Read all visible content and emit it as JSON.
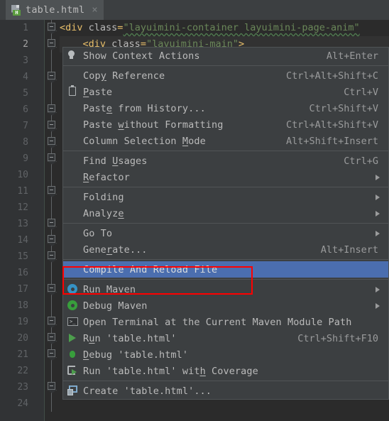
{
  "tab": {
    "filename": "table.html",
    "close_label": "×",
    "icon": "html-file-icon",
    "badge": "H"
  },
  "editor": {
    "line_numbers": [
      1,
      2,
      3,
      4,
      5,
      6,
      7,
      8,
      9,
      10,
      11,
      12,
      13,
      14,
      15,
      16,
      17,
      18,
      19,
      20,
      21,
      22,
      23,
      24
    ],
    "current_line": 2,
    "lines": [
      {
        "n": 1,
        "segments": [
          {
            "text": "<div",
            "type": "tag"
          },
          {
            "text": " ",
            "type": "plain"
          },
          {
            "text": "class",
            "type": "attr"
          },
          {
            "text": "=",
            "type": "tag"
          },
          {
            "text": "\"layuimini-container layuimini-page-anim\"",
            "type": "str"
          }
        ]
      },
      {
        "n": 2,
        "segments": [
          {
            "text": "    <div",
            "type": "tag"
          },
          {
            "text": " ",
            "type": "plain"
          },
          {
            "text": "class",
            "type": "attr"
          },
          {
            "text": "=",
            "type": "tag"
          },
          {
            "text": "\"layuimini-main\"",
            "type": "str"
          },
          {
            "text": ">",
            "type": "tag"
          }
        ]
      }
    ]
  },
  "context_menu": {
    "groups": [
      {
        "items": [
          {
            "label": "Show Context Actions",
            "shortcut": "Alt+Enter",
            "icon": "lightbulb-icon",
            "submenu": false,
            "selected": false
          }
        ]
      },
      {
        "items": [
          {
            "label": "Copy Reference",
            "shortcut": "Ctrl+Alt+Shift+C",
            "icon": "",
            "submenu": false,
            "selected": false,
            "mnemonic": 3
          },
          {
            "label": "Paste",
            "shortcut": "Ctrl+V",
            "icon": "clipboard-icon",
            "submenu": false,
            "selected": false,
            "mnemonic": 0
          },
          {
            "label": "Paste from History...",
            "shortcut": "Ctrl+Shift+V",
            "icon": "",
            "submenu": false,
            "selected": false,
            "mnemonic": 4
          },
          {
            "label": "Paste without Formatting",
            "shortcut": "Ctrl+Alt+Shift+V",
            "icon": "",
            "submenu": false,
            "selected": false,
            "mnemonic": 6
          },
          {
            "label": "Column Selection Mode",
            "shortcut": "Alt+Shift+Insert",
            "icon": "",
            "submenu": false,
            "selected": false,
            "mnemonic": 17
          }
        ]
      },
      {
        "items": [
          {
            "label": "Find Usages",
            "shortcut": "Ctrl+G",
            "icon": "",
            "submenu": false,
            "selected": false,
            "mnemonic": 5
          },
          {
            "label": "Refactor",
            "shortcut": "",
            "icon": "",
            "submenu": true,
            "selected": false,
            "mnemonic": 0
          }
        ]
      },
      {
        "items": [
          {
            "label": "Folding",
            "shortcut": "",
            "icon": "",
            "submenu": true,
            "selected": false
          },
          {
            "label": "Analyze",
            "shortcut": "",
            "icon": "",
            "submenu": true,
            "selected": false,
            "mnemonic": 6
          }
        ]
      },
      {
        "items": [
          {
            "label": "Go To",
            "shortcut": "",
            "icon": "",
            "submenu": true,
            "selected": false
          },
          {
            "label": "Generate...",
            "shortcut": "Alt+Insert",
            "icon": "",
            "submenu": false,
            "selected": false,
            "mnemonic": 4
          }
        ]
      },
      {
        "items": [
          {
            "label": "Compile And Reload File",
            "shortcut": "",
            "icon": "",
            "submenu": false,
            "selected": true
          }
        ]
      },
      {
        "items": [
          {
            "label": "Run Maven",
            "shortcut": "",
            "icon": "blue-gear-icon",
            "submenu": true,
            "selected": false
          },
          {
            "label": "Debug Maven",
            "shortcut": "",
            "icon": "green-gear-icon",
            "submenu": true,
            "selected": false
          },
          {
            "label": "Open Terminal at the Current Maven Module Path",
            "shortcut": "",
            "icon": "terminal-icon",
            "submenu": false,
            "selected": false
          },
          {
            "label": "Run 'table.html'",
            "shortcut": "Ctrl+Shift+F10",
            "icon": "run-play-icon",
            "submenu": false,
            "selected": false,
            "mnemonic": 1
          },
          {
            "label": "Debug 'table.html'",
            "shortcut": "",
            "icon": "debug-bug-icon",
            "submenu": false,
            "selected": false,
            "mnemonic": 0
          },
          {
            "label": "Run 'table.html' with Coverage",
            "shortcut": "",
            "icon": "coverage-icon",
            "submenu": false,
            "selected": false,
            "mnemonic": 20
          }
        ]
      },
      {
        "items": [
          {
            "label": "Create 'table.html'...",
            "shortcut": "",
            "icon": "create-config-icon",
            "submenu": false,
            "selected": false
          }
        ]
      }
    ]
  },
  "annotation": {
    "type": "red-rectangle-highlight",
    "target": "Compile And Reload File",
    "color": "#ff0000"
  },
  "colors": {
    "editor_background": "#2b2b2b",
    "gutter_background": "#313335",
    "menu_background": "#3c3f41",
    "selection_blue": "#4b6eaf",
    "tag_orange": "#e8bf6a",
    "string_green": "#6a8759",
    "text_gray": "#bbbbbb",
    "annotation_red": "#ff0000"
  }
}
